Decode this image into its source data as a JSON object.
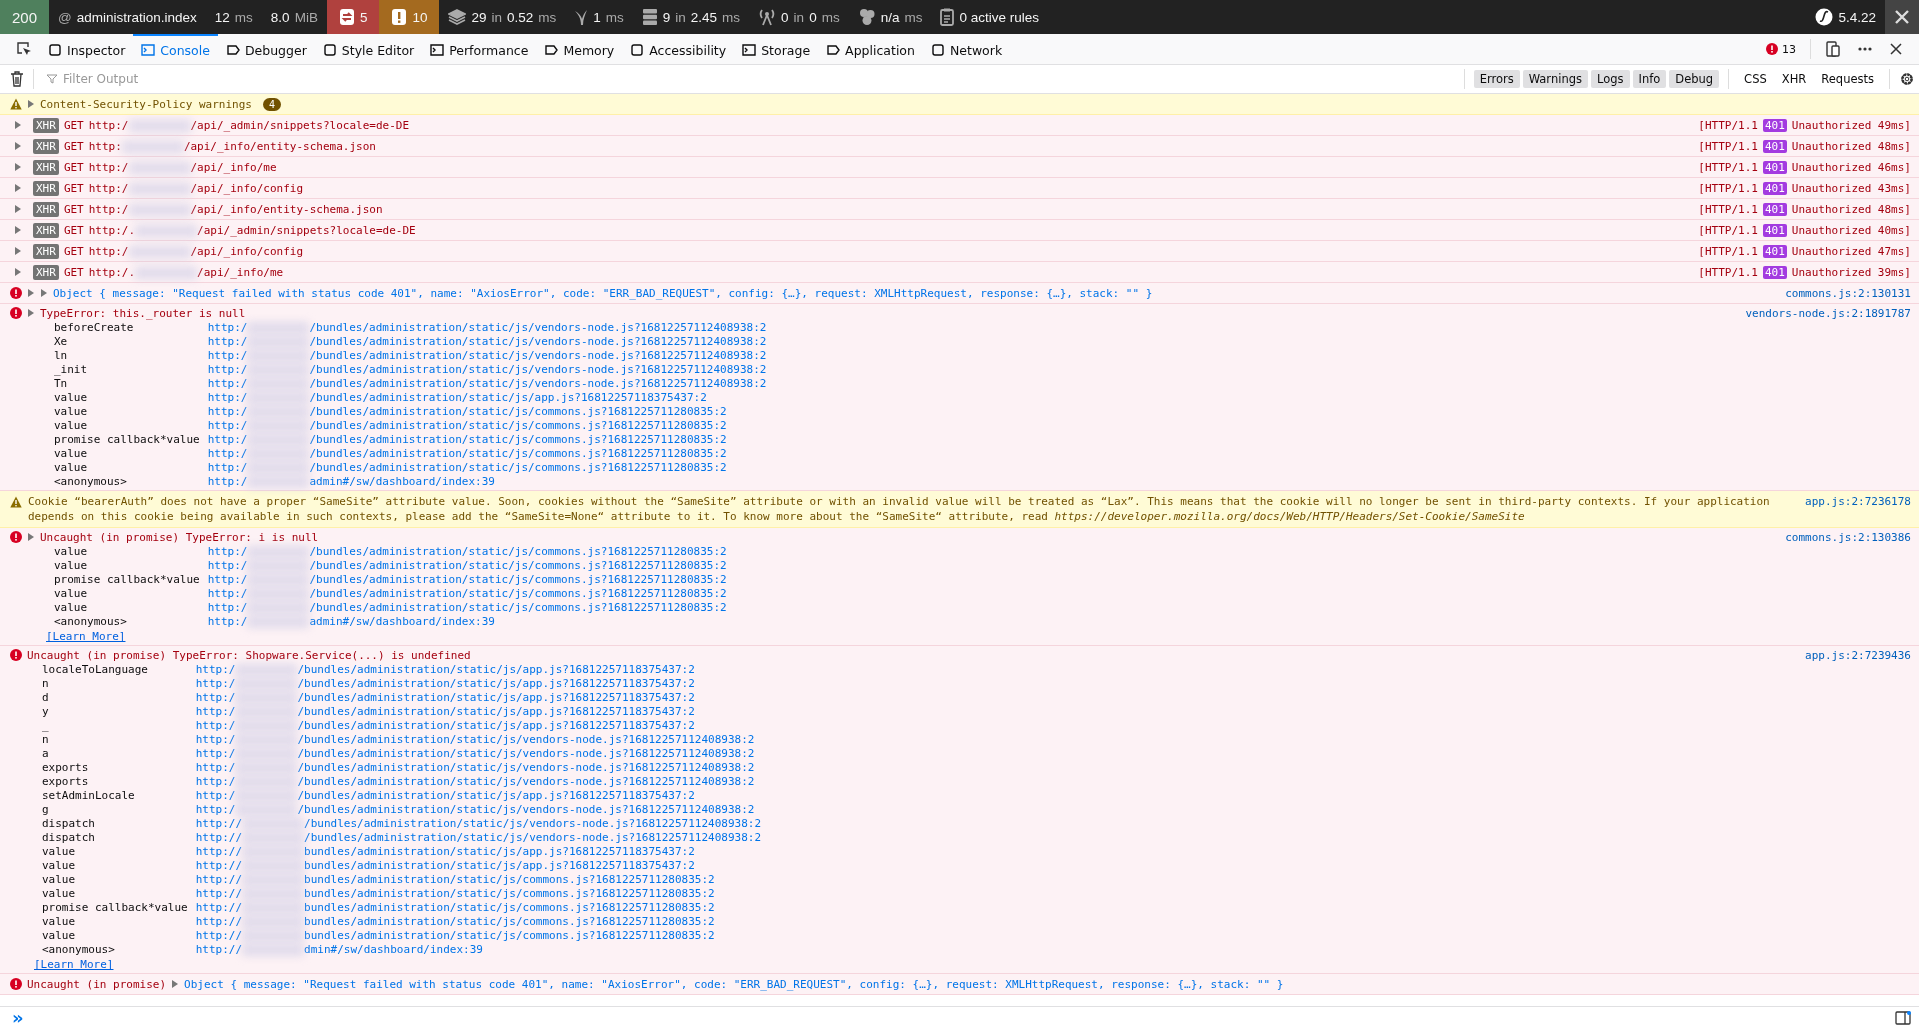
{
  "symfony_bar": {
    "status": "200",
    "route_mark": "@",
    "route": "administration.index",
    "time_value": "12",
    "time_unit": "ms",
    "memory_value": "8.0",
    "memory_unit": "MiB",
    "panels": [
      {
        "value": "5",
        "color": "#b0413e"
      },
      {
        "value": "10",
        "color": "#a46a1f"
      },
      {
        "value": "29",
        "sep": "in",
        "time": "0.52",
        "unit": "ms"
      },
      {
        "value": "1",
        "unit": "ms"
      },
      {
        "value": "9",
        "sep": "in",
        "time": "2.45",
        "unit": "ms"
      },
      {
        "value": "0",
        "sep": "in",
        "time": "0",
        "unit": "ms"
      },
      {
        "value": "n/a",
        "unit": "ms"
      },
      {
        "value": "0 active rules"
      }
    ],
    "version": "5.4.22"
  },
  "devtools": {
    "tabs": [
      {
        "label": "Inspector",
        "selected": false
      },
      {
        "label": "Console",
        "selected": true
      },
      {
        "label": "Debugger",
        "selected": false
      },
      {
        "label": "Style Editor",
        "selected": false
      },
      {
        "label": "Performance",
        "selected": false
      },
      {
        "label": "Memory",
        "selected": false
      },
      {
        "label": "Accessibility",
        "selected": false
      },
      {
        "label": "Storage",
        "selected": false
      },
      {
        "label": "Application",
        "selected": false
      },
      {
        "label": "Network",
        "selected": false
      }
    ],
    "error_count": "13"
  },
  "filter": {
    "placeholder": "Filter Output",
    "levels": [
      {
        "label": "Errors",
        "selected": true
      },
      {
        "label": "Warnings",
        "selected": true
      },
      {
        "label": "Logs",
        "selected": true
      },
      {
        "label": "Info",
        "selected": true
      },
      {
        "label": "Debug",
        "selected": true
      }
    ],
    "types": [
      {
        "label": "CSS",
        "selected": false
      },
      {
        "label": "XHR",
        "selected": false
      },
      {
        "label": "Requests",
        "selected": false
      }
    ]
  },
  "messages": [
    {
      "kind": "group",
      "text": "Content-Security-Policy warnings",
      "count": "4"
    },
    {
      "kind": "xhr",
      "tag": "XHR",
      "method": "GET",
      "url_start": "http:/",
      "url_end": "/api/_admin/snippets?locale=de-DE",
      "protocol": "[HTTP/1.1",
      "code": "401",
      "result": "Unauthorized 49ms]"
    },
    {
      "kind": "xhr",
      "tag": "XHR",
      "method": "GET",
      "url_start": "http:",
      "url_end": "/api/_info/entity-schema.json",
      "protocol": "[HTTP/1.1",
      "code": "401",
      "result": "Unauthorized 48ms]"
    },
    {
      "kind": "xhr",
      "tag": "XHR",
      "method": "GET",
      "url_start": "http:/",
      "url_end": "/api/_info/me",
      "protocol": "[HTTP/1.1",
      "code": "401",
      "result": "Unauthorized 46ms]"
    },
    {
      "kind": "xhr",
      "tag": "XHR",
      "method": "GET",
      "url_start": "http:/",
      "url_end": "/api/_info/config",
      "protocol": "[HTTP/1.1",
      "code": "401",
      "result": "Unauthorized 43ms]"
    },
    {
      "kind": "xhr",
      "tag": "XHR",
      "method": "GET",
      "url_start": "http:/",
      "url_end": "/api/_info/entity-schema.json",
      "protocol": "[HTTP/1.1",
      "code": "401",
      "result": "Unauthorized 48ms]"
    },
    {
      "kind": "xhr",
      "tag": "XHR",
      "method": "GET",
      "url_start": "http:/.",
      "url_end": "/api/_admin/snippets?locale=de-DE",
      "protocol": "[HTTP/1.1",
      "code": "401",
      "result": "Unauthorized 40ms]"
    },
    {
      "kind": "xhr",
      "tag": "XHR",
      "method": "GET",
      "url_start": "http:/",
      "url_end": "/api/_info/config",
      "protocol": "[HTTP/1.1",
      "code": "401",
      "result": "Unauthorized 47ms]"
    },
    {
      "kind": "xhr",
      "tag": "XHR",
      "method": "GET",
      "url_start": "http:/.",
      "url_end": "/api/_info/me",
      "protocol": "[HTTP/1.1",
      "code": "401",
      "result": "Unauthorized 39ms]"
    },
    {
      "kind": "object",
      "expandable": true,
      "text": "Object { message: \"Request failed with status code 401\", name: \"AxiosError\", code: \"ERR_BAD_REQUEST\", config: {…}, request: XMLHttpRequest, response: {…}, stack: \"\" }",
      "source": "commons.js:2:130131"
    },
    {
      "kind": "error",
      "expandable": true,
      "text": "TypeError: this._router is null",
      "source": "vendors-node.js:2:1891787",
      "frames": [
        {
          "fn": "beforeCreate",
          "url_start": "http:/",
          "url_end": "/bundles/administration/static/js/vendors-node.js?16812257112408938:2"
        },
        {
          "fn": "Xe",
          "url_start": "http:/",
          "url_end": "/bundles/administration/static/js/vendors-node.js?16812257112408938:2"
        },
        {
          "fn": "ln",
          "url_start": "http:/",
          "url_end": "/bundles/administration/static/js/vendors-node.js?16812257112408938:2"
        },
        {
          "fn": "_init",
          "url_start": "http:/",
          "url_end": "/bundles/administration/static/js/vendors-node.js?16812257112408938:2"
        },
        {
          "fn": "Tn",
          "url_start": "http:/",
          "url_end": "/bundles/administration/static/js/vendors-node.js?16812257112408938:2"
        },
        {
          "fn": "value",
          "url_start": "http:/",
          "url_end": "/bundles/administration/static/js/app.js?16812257118375437:2"
        },
        {
          "fn": "value",
          "url_start": "http:/",
          "url_end": "/bundles/administration/static/js/commons.js?1681225711280835:2"
        },
        {
          "fn": "value",
          "url_start": "http:/",
          "url_end": "/bundles/administration/static/js/commons.js?1681225711280835:2"
        },
        {
          "fn": "promise callback*value",
          "url_start": "http:/",
          "url_end": "/bundles/administration/static/js/commons.js?1681225711280835:2"
        },
        {
          "fn": "value",
          "url_start": "http:/",
          "url_end": "/bundles/administration/static/js/commons.js?1681225711280835:2"
        },
        {
          "fn": "value",
          "url_start": "http:/",
          "url_end": "/bundles/administration/static/js/commons.js?1681225711280835:2"
        },
        {
          "fn": "<anonymous>",
          "url_start": "http:/",
          "url_end": "admin#/sw/dashboard/index:39"
        }
      ]
    },
    {
      "kind": "warning",
      "text": "Cookie “bearerAuth” does not have a proper “SameSite” attribute value. Soon, cookies without the “SameSite” attribute or with an invalid value will be treated as “Lax”. This means that the cookie will no longer be sent in third-party contexts. If your application depends on this cookie being available in such contexts, please add the “SameSite=None“ attribute to it. To know more about the “SameSite“ attribute, read *https://developer.mozilla.org/docs/Web/HTTP/Headers/Set-Cookie/SameSite*",
      "source": "app.js:2:7236178"
    },
    {
      "kind": "error",
      "expandable": true,
      "text": "Uncaught (in promise) TypeError: i is null",
      "source": "commons.js:2:130386",
      "frames": [
        {
          "fn": "value",
          "url_start": "http:/",
          "url_end": "/bundles/administration/static/js/commons.js?1681225711280835:2"
        },
        {
          "fn": "value",
          "url_start": "http:/",
          "url_end": "/bundles/administration/static/js/commons.js?1681225711280835:2"
        },
        {
          "fn": "promise callback*value",
          "url_start": "http:/",
          "url_end": "/bundles/administration/static/js/commons.js?1681225711280835:2"
        },
        {
          "fn": "value",
          "url_start": "http:/",
          "url_end": "/bundles/administration/static/js/commons.js?1681225711280835:2"
        },
        {
          "fn": "value",
          "url_start": "http:/",
          "url_end": "/bundles/administration/static/js/commons.js?1681225711280835:2"
        },
        {
          "fn": "<anonymous>",
          "url_start": "http:/",
          "url_end": "admin#/sw/dashboard/index:39"
        }
      ],
      "learn_more": "[Learn More]"
    },
    {
      "kind": "error",
      "expandable": false,
      "text": "Uncaught (in promise) TypeError: Shopware.Service(...) is undefined",
      "source": "app.js:2:7239436",
      "frames": [
        {
          "fn": "localeToLanguage",
          "url_start": "http:/",
          "url_end": "/bundles/administration/static/js/app.js?16812257118375437:2"
        },
        {
          "fn": "n",
          "url_start": "http:/",
          "url_end": "/bundles/administration/static/js/app.js?16812257118375437:2"
        },
        {
          "fn": "d",
          "url_start": "http:/",
          "url_end": "/bundles/administration/static/js/app.js?16812257118375437:2"
        },
        {
          "fn": "y",
          "url_start": "http:/",
          "url_end": "/bundles/administration/static/js/app.js?16812257118375437:2"
        },
        {
          "fn": "_",
          "url_start": "http:/",
          "url_end": "/bundles/administration/static/js/app.js?16812257118375437:2"
        },
        {
          "fn": "n",
          "url_start": "http:/",
          "url_end": "/bundles/administration/static/js/vendors-node.js?16812257112408938:2"
        },
        {
          "fn": "a",
          "url_start": "http:/",
          "url_end": "/bundles/administration/static/js/vendors-node.js?16812257112408938:2"
        },
        {
          "fn": "exports",
          "url_start": "http:/",
          "url_end": "/bundles/administration/static/js/vendors-node.js?16812257112408938:2"
        },
        {
          "fn": "exports",
          "url_start": "http:/",
          "url_end": "/bundles/administration/static/js/vendors-node.js?16812257112408938:2"
        },
        {
          "fn": "setAdminLocale",
          "url_start": "http:/",
          "url_end": "/bundles/administration/static/js/app.js?16812257118375437:2"
        },
        {
          "fn": "g",
          "url_start": "http:/",
          "url_end": "/bundles/administration/static/js/vendors-node.js?16812257112408938:2"
        },
        {
          "fn": "dispatch",
          "url_start": "http://",
          "url_end": "/bundles/administration/static/js/vendors-node.js?16812257112408938:2"
        },
        {
          "fn": "dispatch",
          "url_start": "http://",
          "url_end": "/bundles/administration/static/js/vendors-node.js?16812257112408938:2"
        },
        {
          "fn": "value",
          "url_start": "http://",
          "url_end": "bundles/administration/static/js/app.js?16812257118375437:2"
        },
        {
          "fn": "value",
          "url_start": "http://",
          "url_end": "bundles/administration/static/js/app.js?16812257118375437:2"
        },
        {
          "fn": "value",
          "url_start": "http://",
          "url_end": "bundles/administration/static/js/commons.js?1681225711280835:2"
        },
        {
          "fn": "value",
          "url_start": "http://",
          "url_end": "bundles/administration/static/js/commons.js?1681225711280835:2"
        },
        {
          "fn": "promise callback*value",
          "url_start": "http://",
          "url_end": "bundles/administration/static/js/commons.js?1681225711280835:2"
        },
        {
          "fn": "value",
          "url_start": "http://",
          "url_end": "bundles/administration/static/js/commons.js?1681225711280835:2"
        },
        {
          "fn": "value",
          "url_start": "http://",
          "url_end": "bundles/administration/static/js/commons.js?1681225711280835:2"
        },
        {
          "fn": "<anonymous>",
          "url_start": "http://",
          "url_end": "dmin#/sw/dashboard/index:39"
        }
      ],
      "learn_more": "[Learn More]"
    },
    {
      "kind": "object",
      "expandable": false,
      "prefix": "Uncaught (in promise)",
      "text": "Object { message: \"Request failed with status code 401\", name: \"AxiosError\", code: \"ERR_BAD_REQUEST\", config: {…}, request: XMLHttpRequest, response: {…}, stack: \"\" }"
    }
  ],
  "prompt": {
    "mark": "»"
  }
}
